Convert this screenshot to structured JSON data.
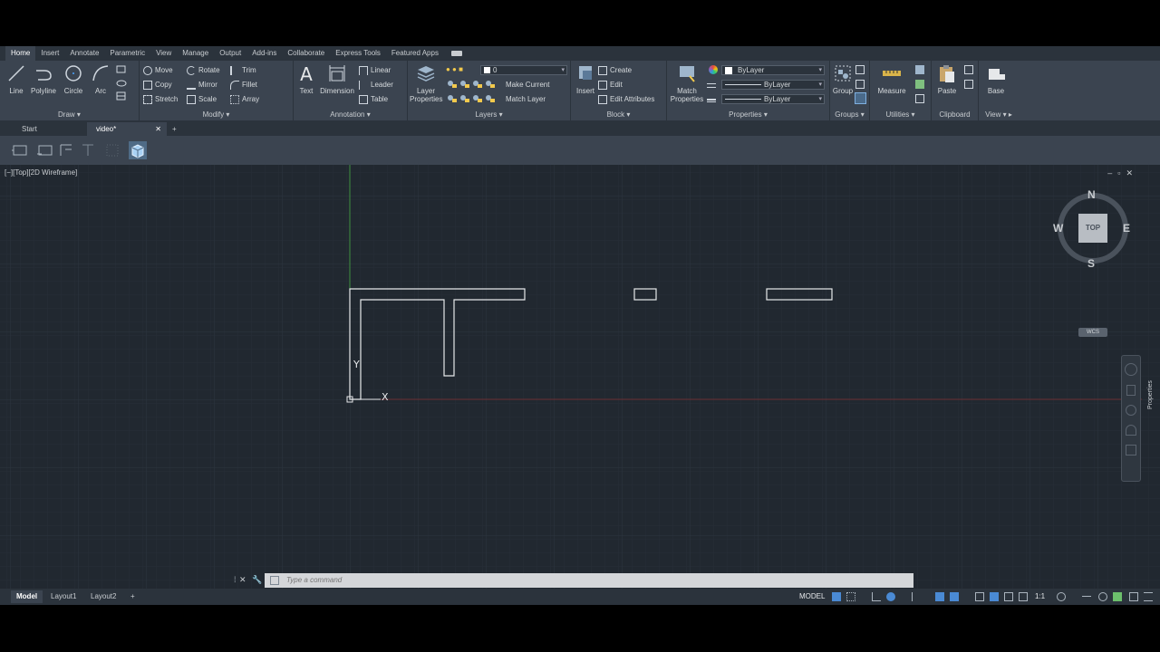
{
  "ribbon_tabs": [
    "Home",
    "Insert",
    "Annotate",
    "Parametric",
    "View",
    "Manage",
    "Output",
    "Add-ins",
    "Collaborate",
    "Express Tools",
    "Featured Apps"
  ],
  "draw": {
    "title": "Draw",
    "line": "Line",
    "polyline": "Polyline",
    "circle": "Circle",
    "arc": "Arc"
  },
  "modify": {
    "title": "Modify",
    "move": "Move",
    "rotate": "Rotate",
    "trim": "Trim",
    "copy": "Copy",
    "mirror": "Mirror",
    "fillet": "Fillet",
    "stretch": "Stretch",
    "scale": "Scale",
    "array": "Array"
  },
  "annotation": {
    "title": "Annotation",
    "text": "Text",
    "dimension": "Dimension",
    "linear": "Linear",
    "leader": "Leader",
    "table": "Table"
  },
  "layers": {
    "title": "Layers",
    "layer_props_1": "Layer",
    "layer_props_2": "Properties",
    "current_layer": "0",
    "make_current": "Make Current",
    "match_layer": "Match Layer"
  },
  "block": {
    "title": "Block",
    "insert": "Insert",
    "create": "Create",
    "edit": "Edit",
    "edit_attributes": "Edit Attributes"
  },
  "properties": {
    "title": "Properties",
    "match_1": "Match",
    "match_2": "Properties",
    "color": "ByLayer",
    "linetype": "ByLayer",
    "lineweight": "ByLayer"
  },
  "groups": {
    "title": "Groups",
    "group": "Group"
  },
  "utilities": {
    "title": "Utilities",
    "measure": "Measure"
  },
  "clipboard": {
    "title": "Clipboard",
    "paste": "Paste"
  },
  "view": {
    "title": "View",
    "base": "Base"
  },
  "file_tabs": {
    "start": "Start",
    "current": "video*"
  },
  "viewport": {
    "label": "[−][Top][2D Wireframe]"
  },
  "viewcube": {
    "n": "N",
    "s": "S",
    "e": "E",
    "w": "W",
    "face": "TOP",
    "wcs": "WCS"
  },
  "ucs": {
    "x": "X",
    "y": "Y"
  },
  "side_palette": "Properties",
  "command": {
    "placeholder": "Type a command"
  },
  "layout_tabs": [
    "Model",
    "Layout1",
    "Layout2"
  ],
  "status": {
    "space": "MODEL",
    "scale": "1:1"
  },
  "colors": {
    "background": "#212830",
    "ribbon": "#3b4450",
    "grid": "#2a323b",
    "geometry": "#e6e8ea",
    "y_axis": "#3f8f3f",
    "x_axis": "#8f3f3f"
  }
}
